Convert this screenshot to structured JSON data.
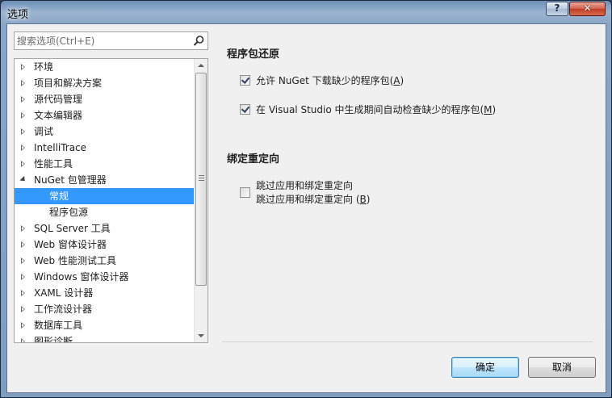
{
  "window": {
    "title": "选项",
    "help_label": "?",
    "close_label": "✕"
  },
  "search": {
    "placeholder": "搜索选项(Ctrl+E)",
    "value": ""
  },
  "tree": {
    "items": [
      {
        "label": "环境"
      },
      {
        "label": "项目和解决方案"
      },
      {
        "label": "源代码管理"
      },
      {
        "label": "文本编辑器"
      },
      {
        "label": "调试"
      },
      {
        "label": "IntelliTrace"
      },
      {
        "label": "性能工具"
      },
      {
        "label": "NuGet 包管理器"
      },
      {
        "label": "常规"
      },
      {
        "label": "程序包源"
      },
      {
        "label": "SQL Server 工具"
      },
      {
        "label": "Web 窗体设计器"
      },
      {
        "label": "Web 性能测试工具"
      },
      {
        "label": "Windows 窗体设计器"
      },
      {
        "label": "XAML 设计器"
      },
      {
        "label": "工作流设计器"
      },
      {
        "label": "数据库工具"
      },
      {
        "label": "图形诊断"
      }
    ]
  },
  "sections": {
    "restore": {
      "title": "程序包还原",
      "opt1_pre": "允许 NuGet 下载缺少的程序包(",
      "opt1_key": "A",
      "opt1_post": ")",
      "opt2_pre": "在 Visual Studio 中生成期间自动检查缺少的程序包(",
      "opt2_key": "M",
      "opt2_post": ")"
    },
    "binding": {
      "title": "绑定重定向",
      "line1": "跳过应用和绑定重定向",
      "line2_pre": "跳过应用和绑定重定向 (",
      "line2_key": "B",
      "line2_post": ")"
    }
  },
  "buttons": {
    "ok": "确定",
    "cancel": "取消"
  },
  "colors": {
    "selection": "#3399ff",
    "dialog_bg": "#f0f0f0"
  }
}
